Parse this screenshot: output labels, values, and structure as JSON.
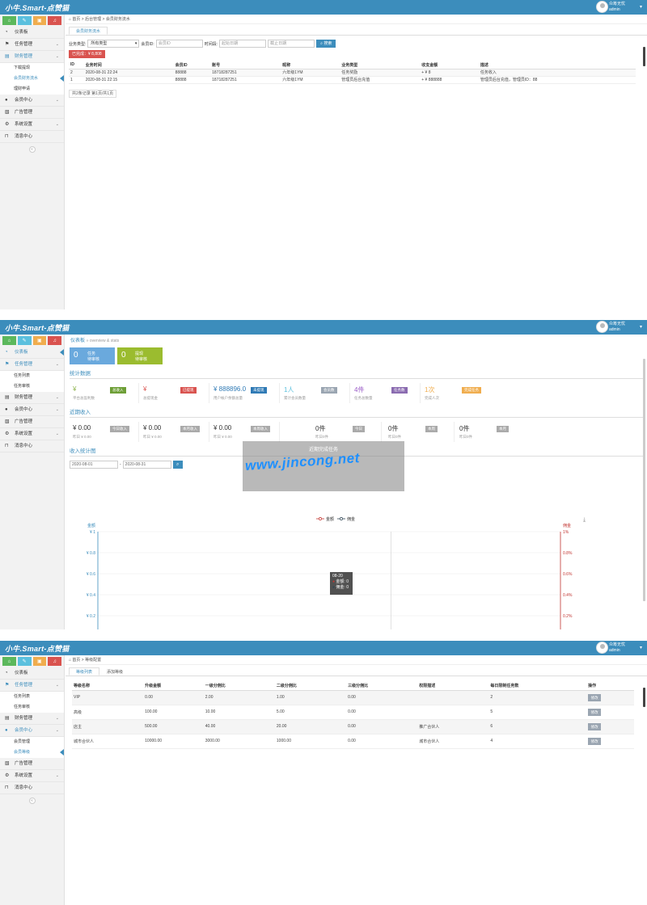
{
  "common": {
    "logo": "小牛.Smart-点赞猫",
    "user_line1": "众筹无忧",
    "user_line2": "admin",
    "collapse_icon": "«"
  },
  "panel1": {
    "sidebar": {
      "items": [
        {
          "label": "仪表板",
          "icon": "dashboard-icon"
        },
        {
          "label": "任务管理",
          "icon": "flag-icon"
        },
        {
          "label": "财务管理",
          "icon": "card-icon"
        },
        {
          "label": "会员中心",
          "icon": "user-icon"
        },
        {
          "label": "广告管理",
          "icon": "image-icon"
        },
        {
          "label": "系统设置",
          "icon": "gear-icon"
        },
        {
          "label": "消息中心",
          "icon": "bookmark-icon"
        }
      ],
      "sub_finance": [
        "下载提现",
        "会员财务流水",
        "理财申请"
      ]
    },
    "breadcrumb": "首页 > 后台管理 > 会员财务流水",
    "tab": "会员财务流水",
    "filter": {
      "type_label": "业务类型:",
      "type_value": "所有类型",
      "member_label": "会员ID:",
      "member_placeholder": "会员ID",
      "time_label": "时间段:",
      "start_placeholder": "起始日期",
      "end_placeholder": "截止日期",
      "search": "搜索"
    },
    "total_badge": "已完成：¥ 8,808",
    "table": {
      "headers": [
        "ID",
        "业务时间",
        "会员ID",
        "账号",
        "昵称",
        "业务类型",
        "收支金额",
        "描述"
      ],
      "rows": [
        [
          "2",
          "2020-08-31 22:24",
          "88888",
          "18718287251",
          "六年级1YM",
          "任务奖励",
          "+ ¥ 8",
          "任务收入"
        ],
        [
          "1",
          "2020-08-31 22:15",
          "88888",
          "18718287251",
          "六年级1YM",
          "管理员后台充值",
          "+ ¥ 888888",
          "管理员后台充值，管理员ID：88"
        ]
      ]
    },
    "pager": "共2条记录 第1页/共1页"
  },
  "panel2": {
    "sidebar": {
      "items": [
        {
          "label": "仪表板",
          "icon": "dashboard-icon"
        },
        {
          "label": "任务管理",
          "icon": "flag-icon"
        },
        {
          "label": "财务管理",
          "icon": "card-icon"
        },
        {
          "label": "会员中心",
          "icon": "user-icon"
        },
        {
          "label": "广告管理",
          "icon": "image-icon"
        },
        {
          "label": "系统设置",
          "icon": "gear-icon"
        },
        {
          "label": "消息中心",
          "icon": "bookmark-icon"
        }
      ],
      "sub_task": [
        "任务列表",
        "任务审核"
      ]
    },
    "crumb_title": "仪表板",
    "crumb_sub": "» overview & stats",
    "tiles": [
      {
        "num": "0",
        "l1": "任务",
        "l2": "待审核",
        "color": "#6aa9dd"
      },
      {
        "num": "0",
        "l1": "提现",
        "l2": "待审核",
        "color": "#9bbc2f"
      }
    ],
    "sec_stats": "统计数据",
    "stats": [
      {
        "val": "¥",
        "lab": "平台总盈利数",
        "badge": "总收入",
        "color": "#8bb24a",
        "bcolor": "#6e9f37"
      },
      {
        "val": "¥",
        "lab": "总提现金",
        "badge": "已提现",
        "color": "#d9534f",
        "bcolor": "#d9534f"
      },
      {
        "val": "¥ 888896.0",
        "lab": "用户帐户余额总量",
        "badge": "未提现",
        "color": "#2f7ab5",
        "bcolor": "#2f7ab5"
      },
      {
        "val": "1人",
        "lab": "累计会员数量",
        "badge": "会员数",
        "color": "#5bc0de",
        "bcolor": "#9aa5b1"
      },
      {
        "val": "4件",
        "lab": "任务总数量",
        "badge": "任务数",
        "color": "#9a5bc7",
        "bcolor": "#8a6bb0"
      },
      {
        "val": "1次",
        "lab": "完成人次",
        "badge": "完成任务",
        "color": "#f0ad4e",
        "bcolor": "#f0ad4e"
      }
    ],
    "sec_recent": "近期收入",
    "recent": [
      {
        "val": "¥ 0.00",
        "lab": "昨日 ¥ 0.00",
        "badge": "今日收入"
      },
      {
        "val": "¥ 0.00",
        "lab": "昨日 ¥ 0.00",
        "badge": "本月收入"
      },
      {
        "val": "¥ 0.00",
        "lab": "昨日 ¥ 0.00",
        "badge": "本周收入"
      },
      {
        "val": "0件",
        "lab": "昨日0件",
        "badge": "今日"
      },
      {
        "val": "0件",
        "lab": "昨日0件",
        "badge": "本周"
      },
      {
        "val": "0件",
        "lab": "昨日0件",
        "badge": "本月"
      }
    ],
    "overlay_title": "近期完成任务",
    "watermark": "www.jincong.net",
    "sec_chart": "收入统计图",
    "date_from": "2020-08-01",
    "date_sep": "-",
    "date_to": "2020-08-31",
    "search_icon": "⌕",
    "download_icon": "⤓",
    "tooltip": {
      "date": "08-20",
      "l1": "金额: 0",
      "l2": "佣金: 0"
    }
  },
  "chart_data": {
    "type": "line",
    "legend": [
      "金额",
      "佣金"
    ],
    "legend_position": "top-center",
    "ylabel": "金额",
    "y2label": "佣金",
    "x_tick_count": 31,
    "series": [
      {
        "name": "金额",
        "values": [
          0,
          0,
          0,
          0,
          0,
          0,
          0,
          0,
          0,
          0,
          0,
          0,
          0,
          0,
          0,
          0,
          0,
          0,
          0,
          0,
          0,
          0,
          0,
          0,
          0,
          0,
          0,
          0,
          0,
          0,
          0
        ]
      },
      {
        "name": "佣金",
        "values": [
          0,
          0,
          0,
          0,
          0,
          0,
          0,
          0,
          0,
          0,
          0,
          0,
          0,
          0,
          0,
          0,
          0,
          0,
          0,
          0,
          0,
          0,
          0,
          0,
          0,
          0,
          0,
          0,
          0,
          0,
          0
        ]
      }
    ],
    "yticks": [
      "¥ 0",
      "¥ 0.2",
      "¥ 0.4",
      "¥ 0.6",
      "¥ 0.8",
      "¥ 1"
    ],
    "y2ticks": [
      "0%",
      "0.2%",
      "0.4%",
      "0.6%",
      "0.8%",
      "1%"
    ],
    "ylim": [
      0,
      1
    ],
    "grid": true,
    "colors": {
      "amount": "#c23531",
      "commission": "#2f4554",
      "left_axis": "#3c8dbc",
      "right_axis": "#c23531"
    }
  },
  "panel3": {
    "sidebar": {
      "items": [
        {
          "label": "仪表板",
          "icon": "dashboard-icon"
        },
        {
          "label": "任务管理",
          "icon": "flag-icon"
        },
        {
          "label": "财务管理",
          "icon": "card-icon"
        },
        {
          "label": "会员中心",
          "icon": "user-icon"
        },
        {
          "label": "广告管理",
          "icon": "image-icon"
        },
        {
          "label": "系统设置",
          "icon": "gear-icon"
        },
        {
          "label": "消息中心",
          "icon": "bookmark-icon"
        }
      ],
      "sub_task": [
        "任务列表",
        "任务审核"
      ],
      "sub_member": [
        "会员管理",
        "会员等级"
      ]
    },
    "breadcrumb": "首页 > 等级配置",
    "tabs": [
      "等级列表",
      "添加等级"
    ],
    "table": {
      "headers": [
        "等级名称",
        "升级金额",
        "一级分佣比",
        "二级分佣比",
        "三级分佣比",
        "权限描述",
        "每日限制任务数",
        "操作"
      ],
      "rows": [
        [
          "VIP",
          "0.00",
          "2.00",
          "1.00",
          "0.00",
          "",
          "2",
          "修改"
        ],
        [
          "高级",
          "100.00",
          "10.00",
          "5.00",
          "0.00",
          "",
          "5",
          "修改"
        ],
        [
          "店主",
          "500.00",
          "40.00",
          "20.00",
          "0.00",
          "推广合伙人",
          "6",
          "修改"
        ],
        [
          "城市合伙人",
          "10000.00",
          "3000.00",
          "1000.00",
          "0.00",
          "城市合伙人",
          "4",
          "修改"
        ]
      ]
    }
  }
}
